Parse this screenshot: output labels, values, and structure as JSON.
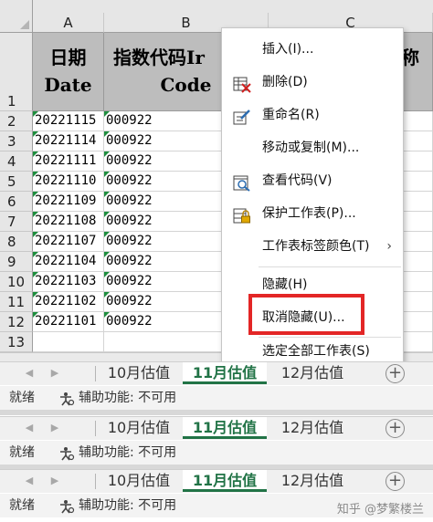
{
  "columns": [
    "A",
    "B",
    "C"
  ],
  "header_row": {
    "row_num": "1",
    "a_line1": "日期",
    "a_line2": "Date",
    "b_line1": "指数代码Ir",
    "b_line2": "Code",
    "c_partial": "称"
  },
  "rows": [
    {
      "num": "2",
      "date": "20221115",
      "code": "000922"
    },
    {
      "num": "3",
      "date": "20221114",
      "code": "000922"
    },
    {
      "num": "4",
      "date": "20221111",
      "code": "000922"
    },
    {
      "num": "5",
      "date": "20221110",
      "code": "000922"
    },
    {
      "num": "6",
      "date": "20221109",
      "code": "000922"
    },
    {
      "num": "7",
      "date": "20221108",
      "code": "000922"
    },
    {
      "num": "8",
      "date": "20221107",
      "code": "000922"
    },
    {
      "num": "9",
      "date": "20221104",
      "code": "000922"
    },
    {
      "num": "10",
      "date": "20221103",
      "code": "000922"
    },
    {
      "num": "11",
      "date": "20221102",
      "code": "000922"
    },
    {
      "num": "12",
      "date": "20221101",
      "code": "000922"
    },
    {
      "num": "13",
      "date": "",
      "code": ""
    }
  ],
  "context_menu": {
    "insert": "插入(I)...",
    "delete": "删除(D)",
    "rename": "重命名(R)",
    "move_copy": "移动或复制(M)...",
    "view_code": "查看代码(V)",
    "protect": "保护工作表(P)...",
    "tab_color": "工作表标签颜色(T)",
    "hide": "隐藏(H)",
    "unhide": "取消隐藏(U)...",
    "select_all": "选定全部工作表(S)"
  },
  "tabs": [
    "10月估值",
    "11月估值",
    "12月估值"
  ],
  "active_tab_index": 1,
  "add_sheet_symbol": "+",
  "status": {
    "ready": "就绪",
    "accessibility": "辅助功能: 不可用"
  },
  "watermark": "知乎 @梦繁楼兰",
  "colors": {
    "accent_green": "#217346",
    "highlight_red": "#e32626",
    "header_gray": "#bdbdbd"
  }
}
